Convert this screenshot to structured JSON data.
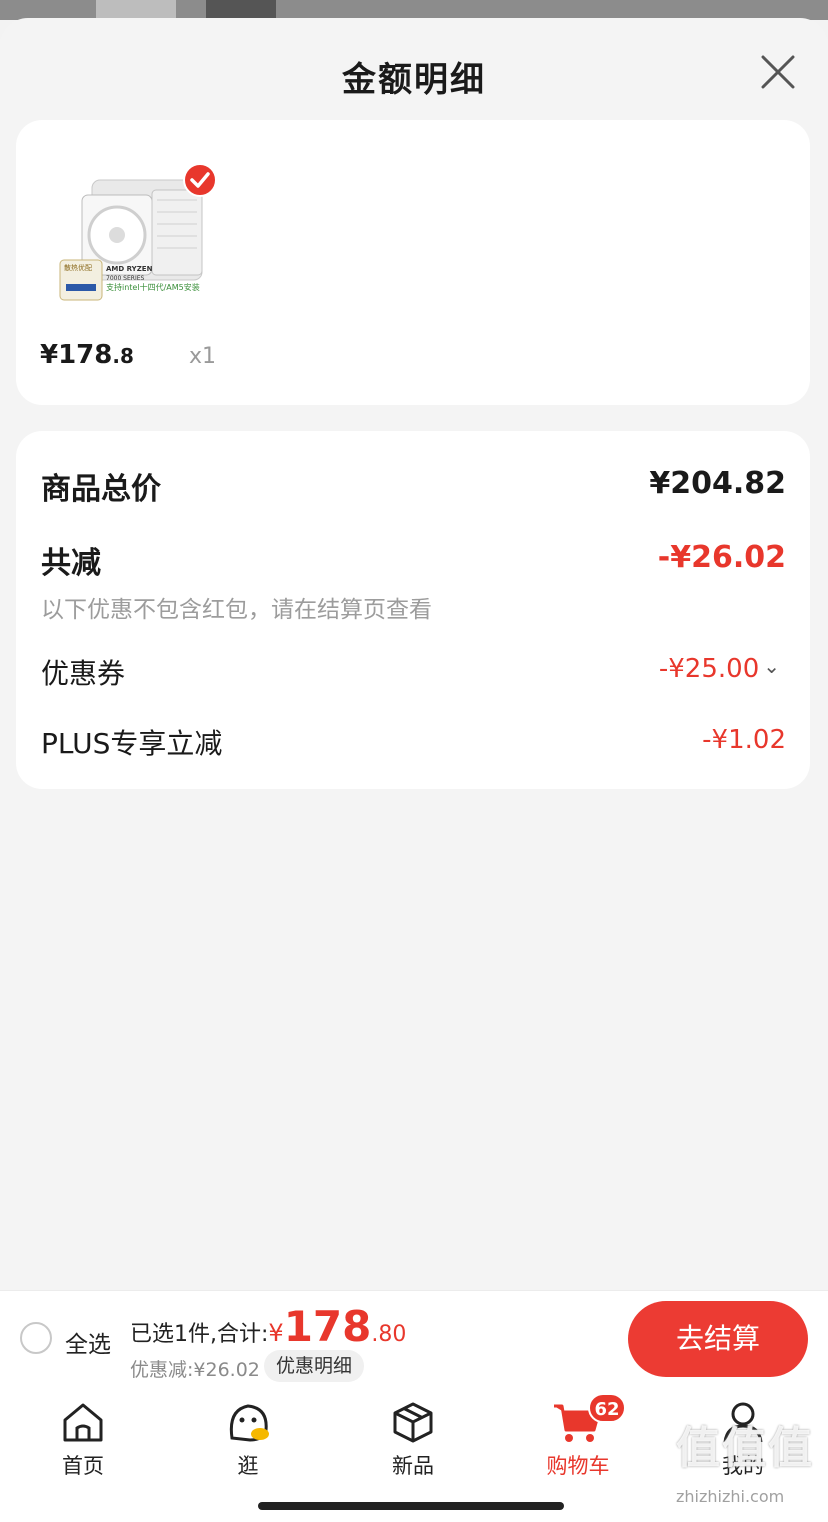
{
  "sheet": {
    "title": "金额明细"
  },
  "product": {
    "price_int": "¥178",
    "price_dec": ".8",
    "quantity": "x1",
    "image_text": {
      "line1": "AMD RYZEN",
      "line2": "7000 SERIES",
      "line3": "支持intel十四代/AM5安装",
      "badge": "散热优配"
    }
  },
  "breakdown": {
    "total_label": "商品总价",
    "total_value": "¥204.82",
    "reduce_label": "共减",
    "reduce_value": "-¥26.02",
    "note": "以下优惠不包含红包，请在结算页查看",
    "coupon_label": "优惠券",
    "coupon_value": "-¥25.00",
    "plus_label": "PLUS专享立减",
    "plus_value": "-¥1.02"
  },
  "checkout": {
    "select_all": "全选",
    "selected_text": "已选1件,合计:",
    "total_yen": "¥",
    "total_int": "178",
    "total_dec": ".80",
    "discount_text": "优惠减:¥26.02",
    "detail_chip": "优惠明细",
    "button": "去结算"
  },
  "tabbar": {
    "home": "首页",
    "browse": "逛",
    "new": "新品",
    "cart": "购物车",
    "cart_badge": "62",
    "me": "我的"
  },
  "watermark": {
    "text": "值值值",
    "url": "zhizhizhi.com"
  },
  "colors": {
    "accent": "#e8372c",
    "card": "#ffffff",
    "sheet_bg": "#f4f4f4"
  }
}
